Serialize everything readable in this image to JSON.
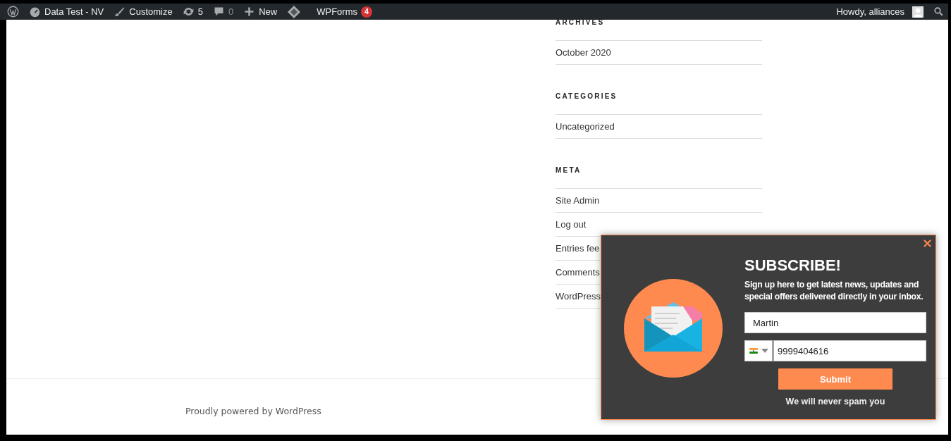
{
  "admin_bar": {
    "items": [
      {
        "kind": "wp-logo"
      },
      {
        "kind": "site",
        "label": "Data Test - NV"
      },
      {
        "kind": "customize",
        "label": "Customize"
      },
      {
        "kind": "updates",
        "label": "5"
      },
      {
        "kind": "comments",
        "label": "0"
      },
      {
        "kind": "new",
        "label": "New"
      },
      {
        "kind": "diamond"
      },
      {
        "kind": "forms",
        "label": "WPForms",
        "badge": "4"
      }
    ],
    "account": {
      "label": "Howdy, alliances"
    }
  },
  "sidebar": {
    "widgets": [
      {
        "title": "ARCHIVES",
        "items": [
          "October 2020"
        ]
      },
      {
        "title": "CATEGORIES",
        "items": [
          "Uncategorized"
        ]
      },
      {
        "title": "META",
        "items": [
          "Site Admin",
          "Log out",
          "Entries fee",
          "Comments",
          "WordPress"
        ]
      }
    ]
  },
  "footer": {
    "text": "Proudly powered by WordPress"
  },
  "popup": {
    "close": "×",
    "title": "SUBSCRIBE!",
    "text": "Sign up here to get latest news, updates and special offers delivered directly in your inbox.",
    "name_field": {
      "value": "Martin"
    },
    "phone_field": {
      "value": "9999404616"
    },
    "submit": "Submit",
    "note": "We will never spam you"
  }
}
